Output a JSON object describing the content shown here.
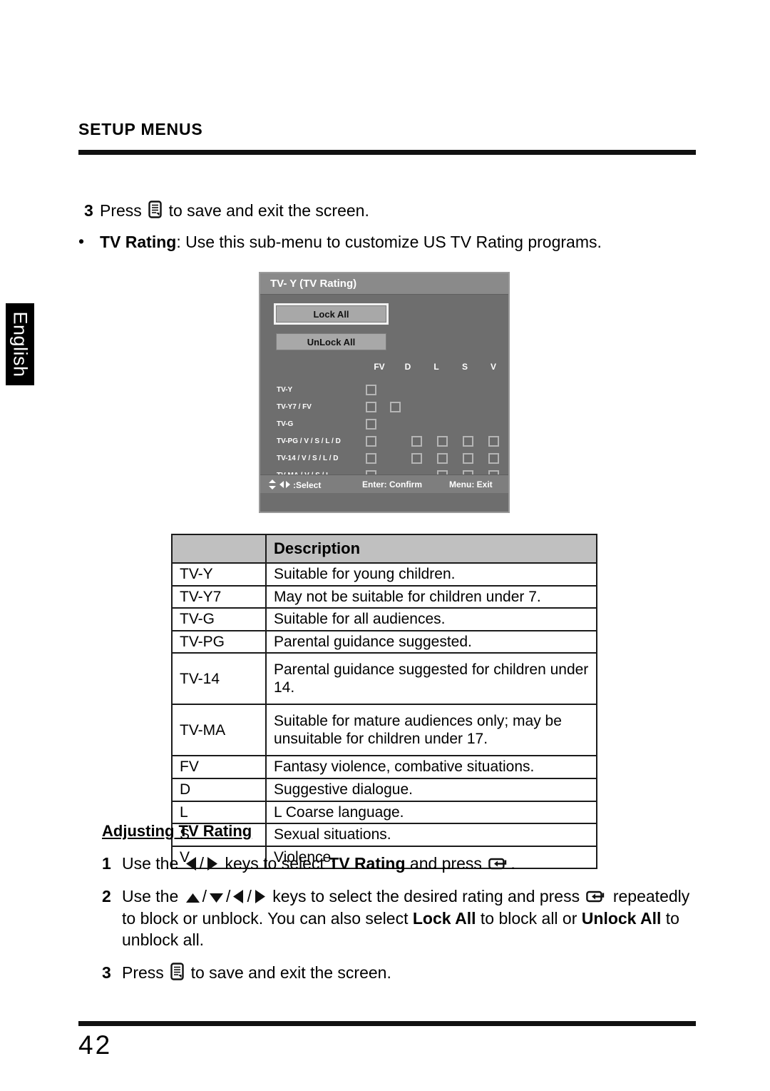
{
  "page": {
    "section_title": "SETUP MENUS",
    "language_tab": "English",
    "page_number": "42"
  },
  "intro": {
    "step3_number": "3",
    "step3_pre": "Press",
    "step3_post": "to save and exit the screen.",
    "bullet_dot": "•",
    "bullet_term": "TV Rating",
    "bullet_text": ": Use this sub-menu to customize US TV Rating programs."
  },
  "osd": {
    "title": "TV- Y (TV Rating)",
    "lock_all": "Lock All",
    "unlock_all": "UnLock All",
    "column_headers": [
      "FV",
      "D",
      "L",
      "S",
      "V"
    ],
    "rows": [
      {
        "label": "TV-Y",
        "boxes": [
          true,
          false,
          false,
          false,
          false,
          false
        ]
      },
      {
        "label": "TV-Y7 / FV",
        "boxes": [
          true,
          true,
          false,
          false,
          false,
          false
        ]
      },
      {
        "label": "TV-G",
        "boxes": [
          true,
          false,
          false,
          false,
          false,
          false
        ]
      },
      {
        "label": "TV-PG / V / S / L / D",
        "boxes": [
          true,
          false,
          true,
          true,
          true,
          true
        ]
      },
      {
        "label": "TV-14 / V / S / L / D",
        "boxes": [
          true,
          false,
          true,
          true,
          true,
          true
        ]
      },
      {
        "label": "TV-MA / V / S / L",
        "boxes": [
          true,
          false,
          false,
          true,
          true,
          true
        ]
      }
    ],
    "footer": {
      "select": ":Select",
      "confirm": "Enter: Confirm",
      "exit": "Menu: Exit"
    }
  },
  "table": {
    "header_blank": "",
    "header_description": "Description",
    "rows": [
      {
        "code": "TV-Y",
        "description": "Suitable for young children."
      },
      {
        "code": "TV-Y7",
        "description": "May not be suitable for children under 7."
      },
      {
        "code": "TV-G",
        "description": "Suitable for all audiences."
      },
      {
        "code": "TV-PG",
        "description": "Parental guidance suggested."
      },
      {
        "code": "TV-14",
        "description": "Parental guidance suggested for children under 14."
      },
      {
        "code": "TV-MA",
        "description": "Suitable for mature audiences only; may be unsuitable for children under 17."
      },
      {
        "code": "FV",
        "description": "Fantasy violence, combative situations."
      },
      {
        "code": "D",
        "description": "Suggestive dialogue."
      },
      {
        "code": "L",
        "description": "L Coarse language."
      },
      {
        "code": "S",
        "description": "Sexual situations."
      },
      {
        "code": "V",
        "description": "Violence."
      }
    ]
  },
  "adjusting": {
    "heading": "Adjusting TV Rating",
    "step1": {
      "number": "1",
      "part1": "Use the",
      "slash": "/",
      "part2": "keys to select",
      "term": "TV Rating",
      "part3": "and press",
      "part4": "."
    },
    "step2": {
      "number": "2",
      "part1": "Use the",
      "slash": "/",
      "part2": "keys to select the desired rating and press",
      "part3": "repeatedly to block or unblock. You can also select",
      "term1": "Lock All",
      "part4": "to block all or",
      "term2": "Unlock All",
      "part5": "to unblock all."
    },
    "step3": {
      "number": "3",
      "pre": "Press",
      "post": "to save and exit the screen."
    }
  },
  "colors": {
    "osd_background": "#6e6e6e",
    "osd_titlebar": "#8a8a8a",
    "osd_button": "#a8a8a8",
    "table_header": "#c0c0c0",
    "rule": "#111111"
  }
}
